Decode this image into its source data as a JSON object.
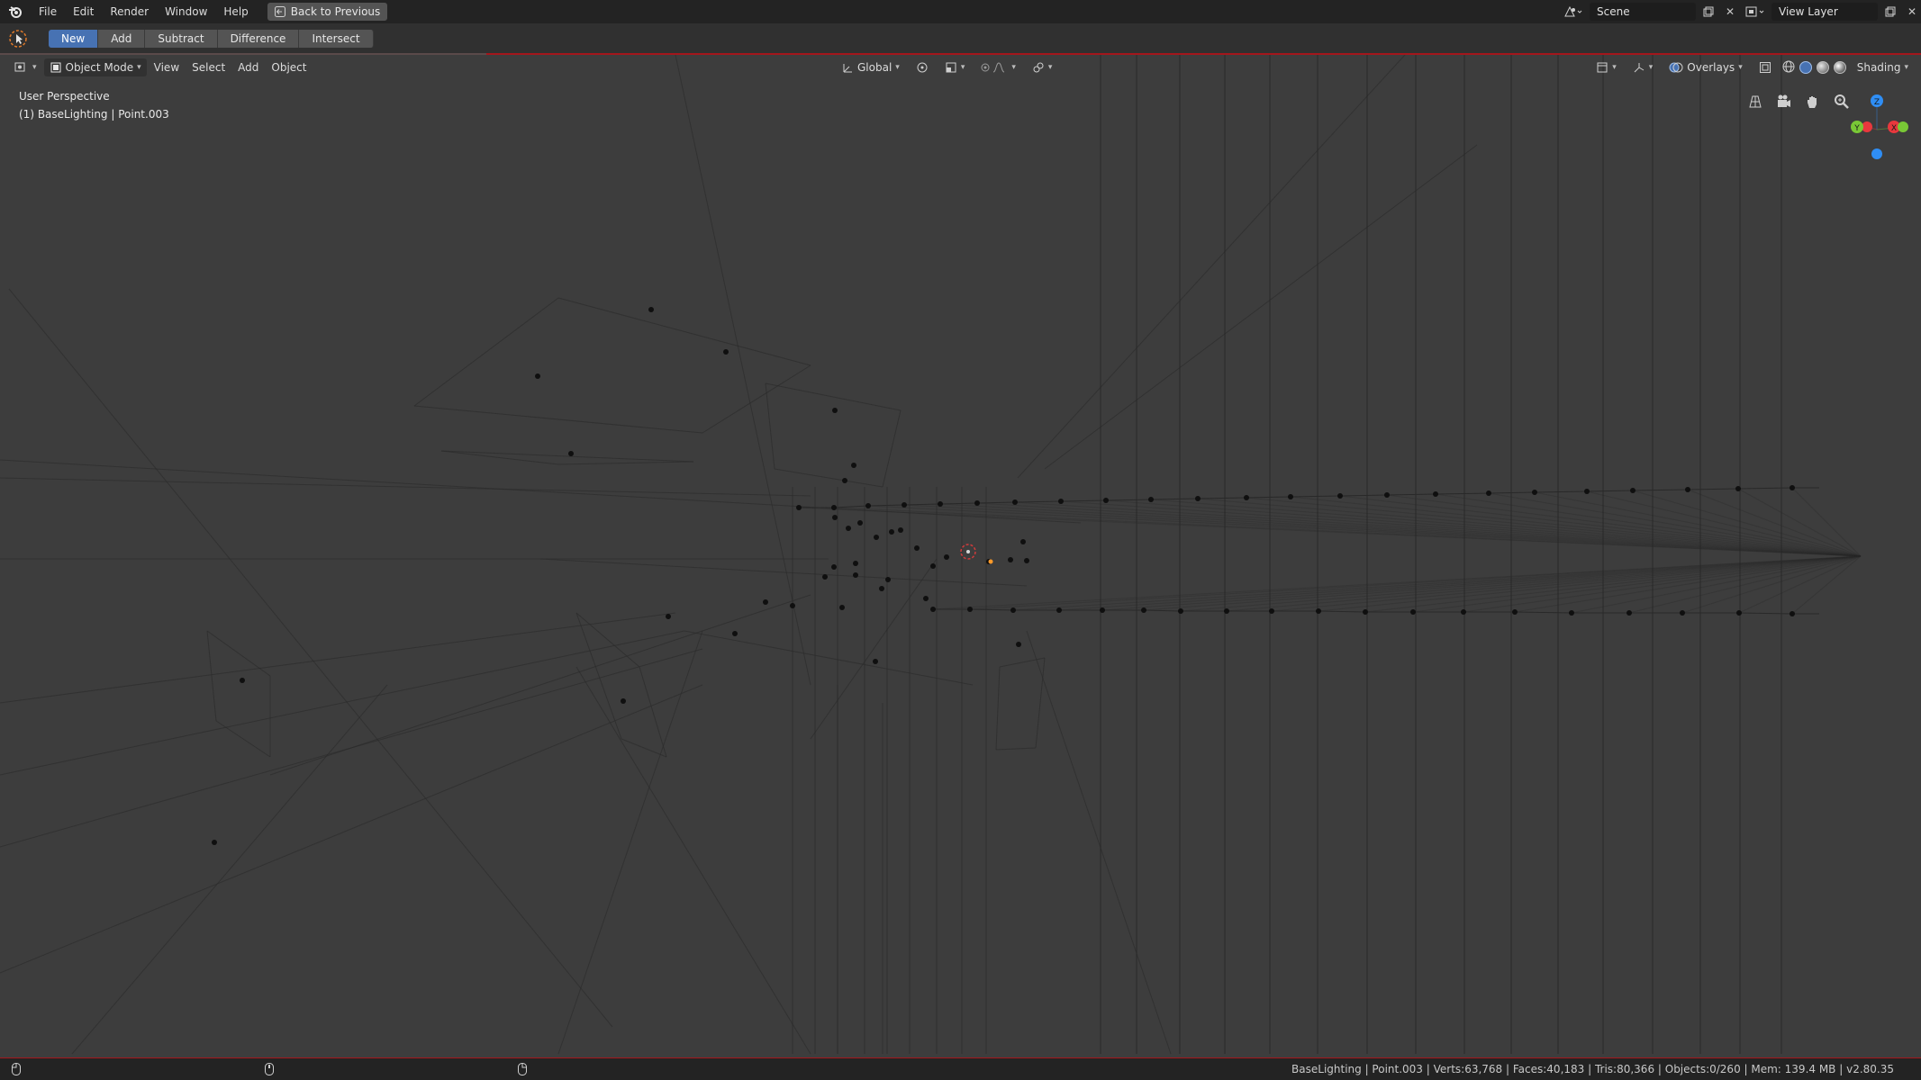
{
  "topbar": {
    "menu": [
      "File",
      "Edit",
      "Render",
      "Window",
      "Help"
    ],
    "back_label": "Back to Previous",
    "scene_label": "Scene",
    "view_layer_label": "View Layer"
  },
  "toolbar": {
    "ops": [
      "New",
      "Add",
      "Subtract",
      "Difference",
      "Intersect"
    ],
    "active_op": "New"
  },
  "viewport": {
    "mode_label": "Object Mode",
    "menu": [
      "View",
      "Select",
      "Add",
      "Object"
    ],
    "transform_orientation": "Global",
    "overlays_label": "Overlays",
    "shading_label": "Shading",
    "perspective_label": "User Perspective",
    "active_object_label": "(1) BaseLighting | Point.003",
    "gizmo": {
      "x": "X",
      "y": "Y",
      "z": "Z"
    }
  },
  "status": {
    "stats": "BaseLighting | Point.003 | Verts:63,768 | Faces:40,183 | Tris:80,366 | Objects:0/260 | Mem: 139.4 MB | v2.80.35"
  },
  "colors": {
    "accent": "#4772b3",
    "header_red": "#a4161c",
    "axis_x": "#e8383d",
    "axis_y": "#79c836",
    "axis_z": "#2f8ef5",
    "selected": "#ff9a2a"
  }
}
